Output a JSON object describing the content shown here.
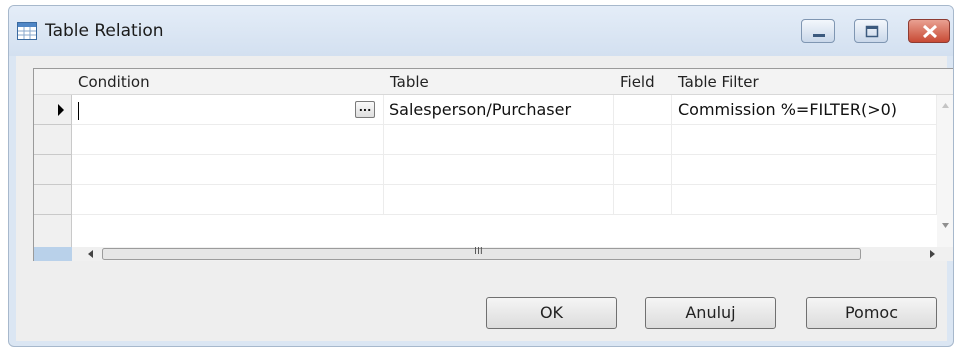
{
  "window": {
    "title": "Table Relation",
    "icons": [
      "table-icon",
      "minimize-icon",
      "maximize-icon",
      "close-icon"
    ]
  },
  "grid": {
    "columns": [
      "Condition",
      "Table",
      "Field",
      "Table Filter"
    ],
    "rows": [
      {
        "condition": "",
        "table": "Salesperson/Purchaser",
        "field": "",
        "table_filter": "Commission %=FILTER(>0)"
      },
      {
        "condition": "",
        "table": "",
        "field": "",
        "table_filter": ""
      },
      {
        "condition": "",
        "table": "",
        "field": "",
        "table_filter": ""
      },
      {
        "condition": "",
        "table": "",
        "field": "",
        "table_filter": ""
      }
    ],
    "assist_button_label": "...",
    "hscroll_grip": "III"
  },
  "buttons": {
    "ok": "OK",
    "cancel": "Anuluj",
    "help": "Pomoc"
  },
  "colors": {
    "titlebar": "#d6e3f2",
    "close_button": "#c84a35",
    "dialog_background": "#eeeeee"
  }
}
